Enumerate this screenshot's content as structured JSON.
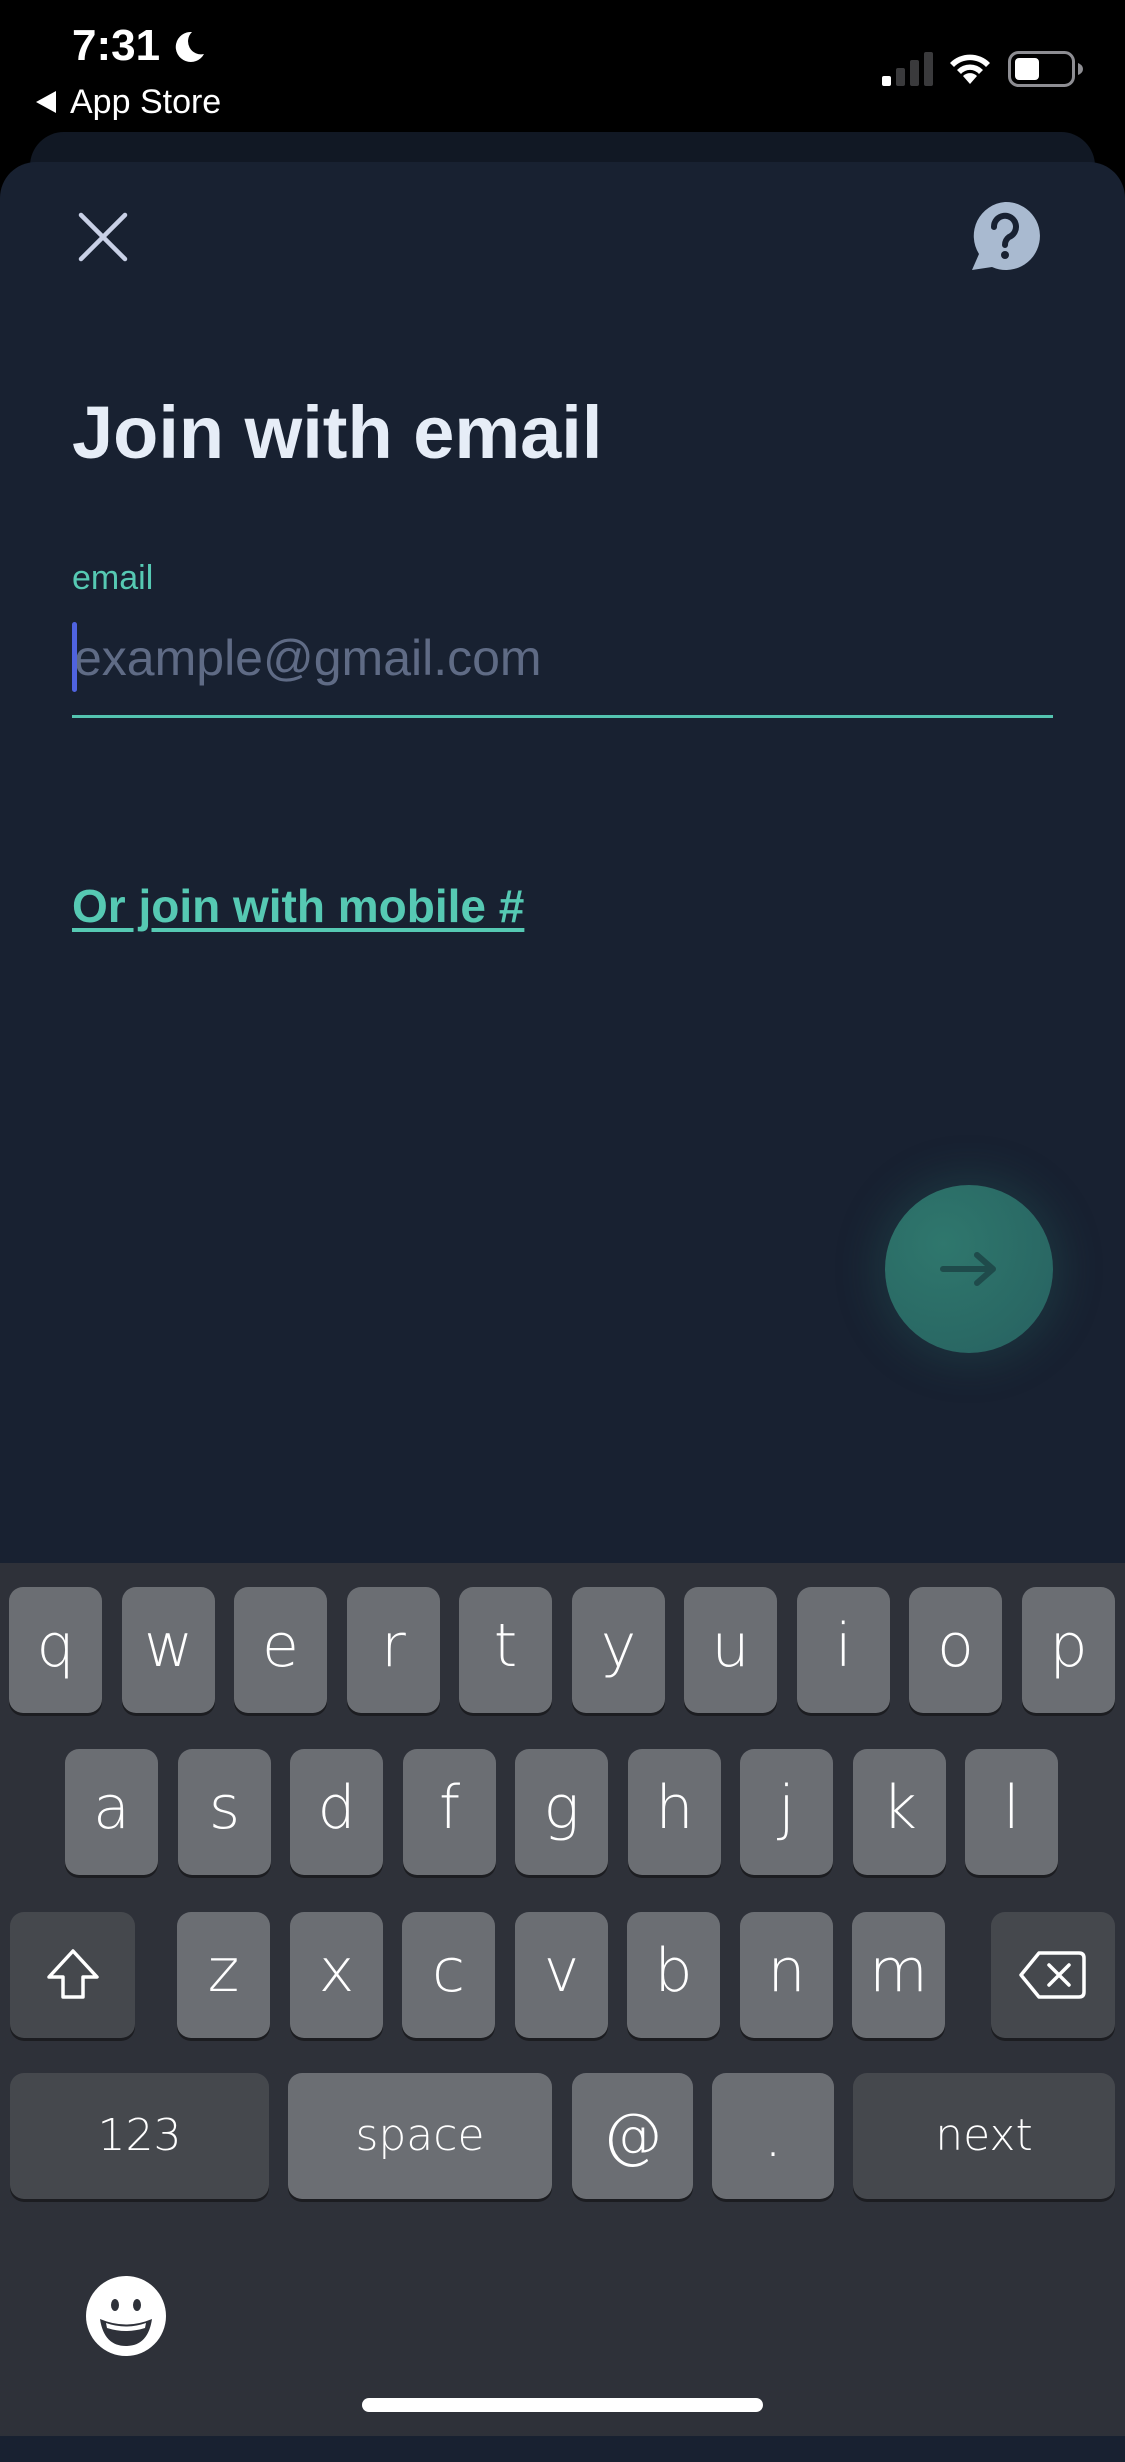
{
  "status_bar": {
    "time": "7:31",
    "focus_icon": "moon-icon",
    "back_label": "App Store",
    "signal_bars_active": 1,
    "signal_bars_total": 4,
    "battery_level_percent": 40
  },
  "header": {
    "close_icon": "close-icon",
    "help_icon": "help-chat-icon"
  },
  "page": {
    "title": "Join with email"
  },
  "email_field": {
    "label": "email",
    "value": "",
    "placeholder": "example@gmail.com"
  },
  "alt_link": "Or join with mobile #",
  "next_button": {
    "icon": "arrow-right-icon",
    "enabled": false
  },
  "colors": {
    "accent": "#56c9b3",
    "background": "#182131",
    "caret": "#4f63e0",
    "title": "#e6edf7",
    "fab": "#2f776d"
  },
  "keyboard": {
    "row1": [
      "q",
      "w",
      "e",
      "r",
      "t",
      "y",
      "u",
      "i",
      "o",
      "p"
    ],
    "row2": [
      "a",
      "s",
      "d",
      "f",
      "g",
      "h",
      "j",
      "k",
      "l"
    ],
    "row3": [
      "z",
      "x",
      "c",
      "v",
      "b",
      "n",
      "m"
    ],
    "shift_icon": "shift-icon",
    "delete_icon": "delete-icon",
    "numbers_label": "123",
    "space_label": "space",
    "at_label": "@",
    "dot_label": ".",
    "return_label": "next",
    "emoji_icon": "emoji-icon"
  }
}
